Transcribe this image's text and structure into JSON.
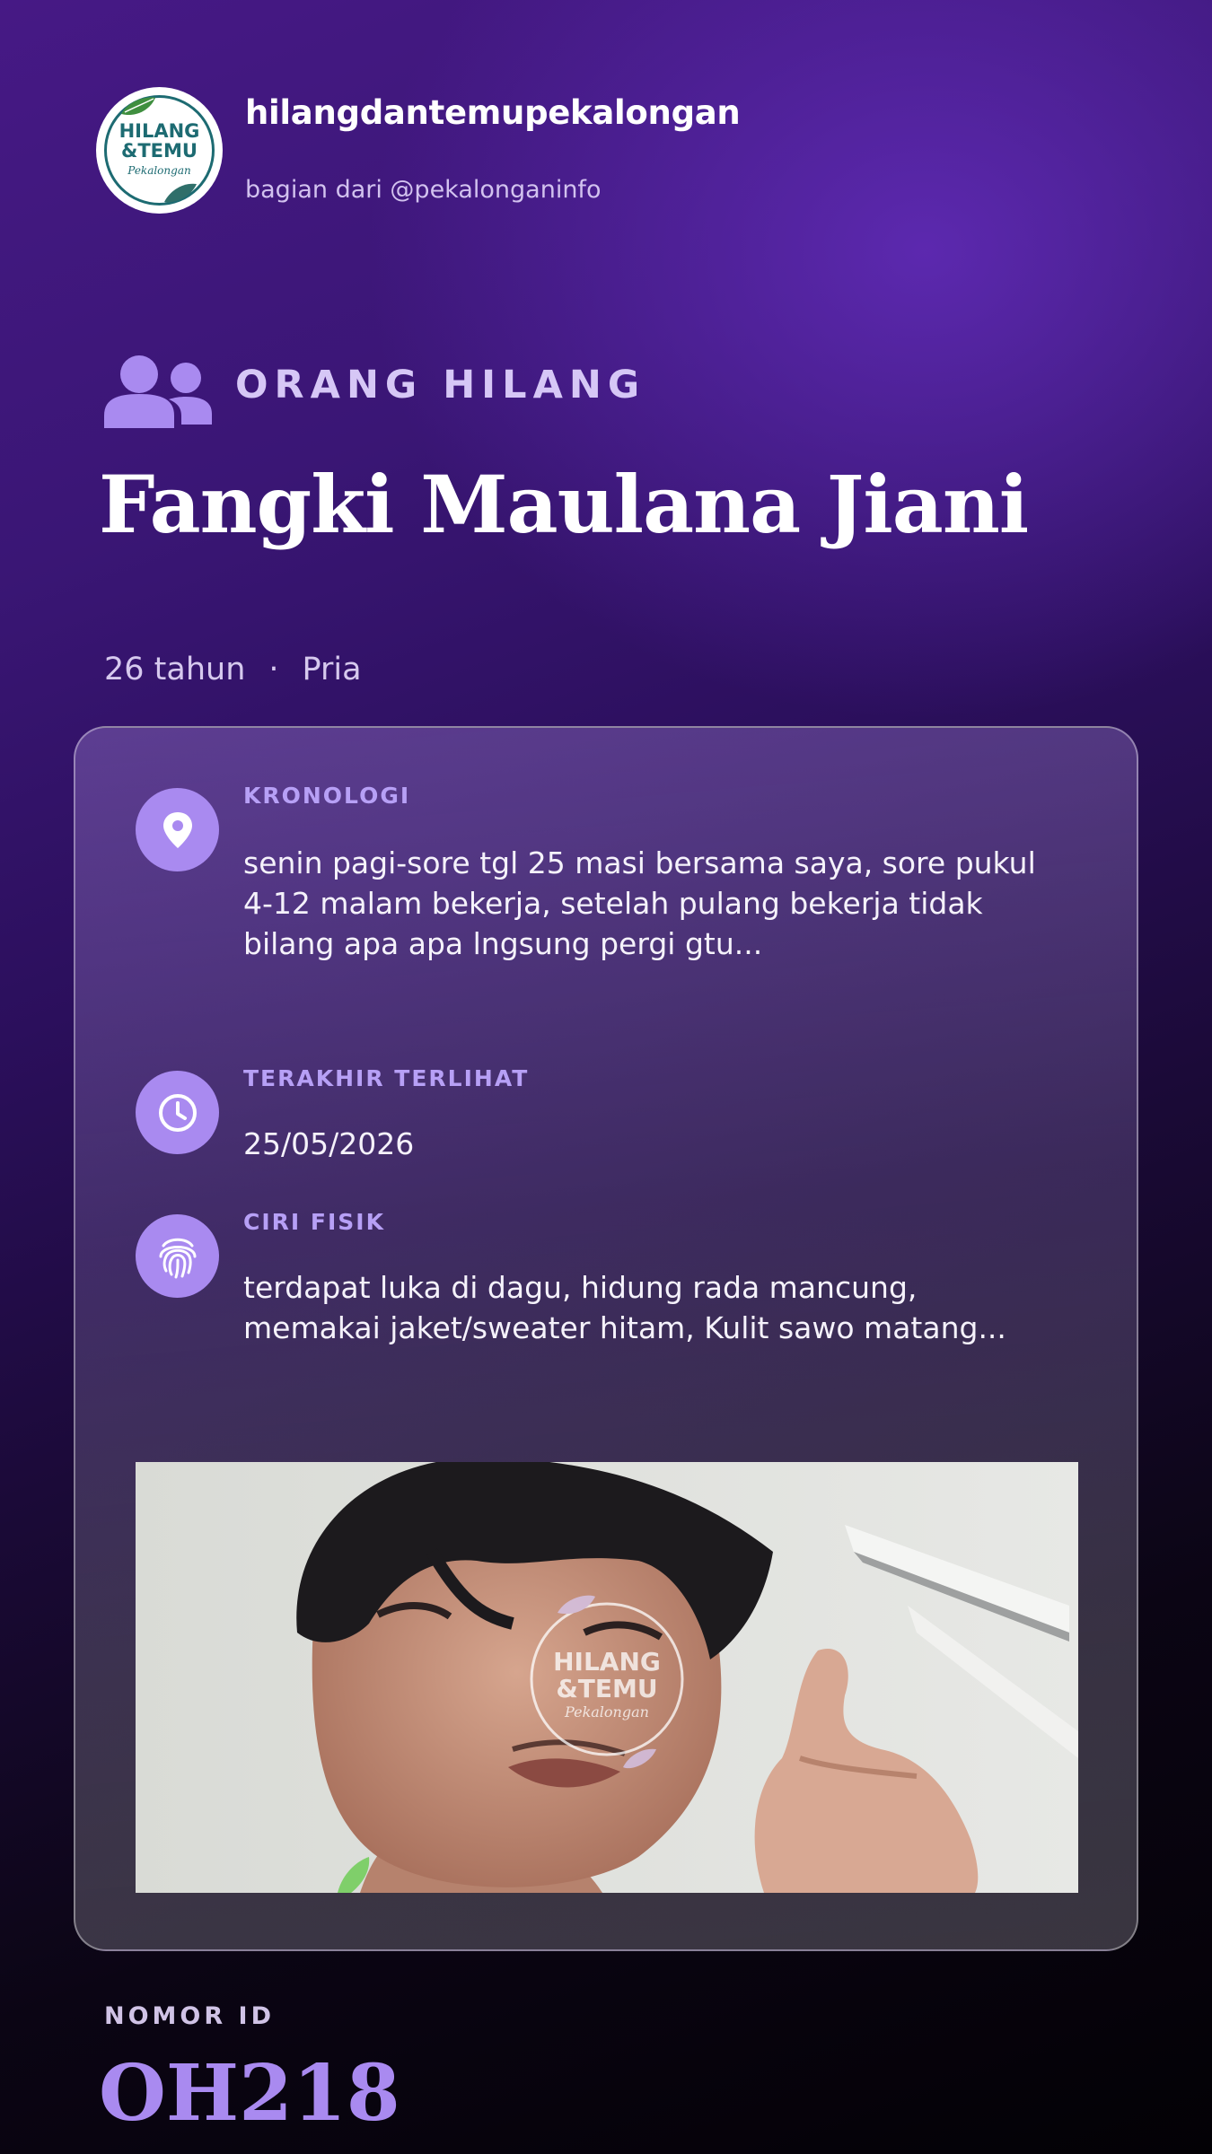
{
  "header": {
    "logo": {
      "icon": "hilang-temu-logo",
      "line1": "HILANG",
      "line2": "&TEMU",
      "line3": "Pekalongan"
    },
    "handle": "hilangdantemupekalongan",
    "subtitle": "bagian dari @pekalonganinfo"
  },
  "category": {
    "icon": "people-icon",
    "label": "ORANG HILANG"
  },
  "person": {
    "name": "Fangki Maulana Jiani",
    "age": "26 tahun",
    "separator": "·",
    "gender": "Pria"
  },
  "details": [
    {
      "icon": "location-pin-icon",
      "label": "KRONOLOGI",
      "text": "senin pagi-sore tgl 25 masi bersama saya, sore pukul 4-12 malam bekerja, setelah pulang bekerja tidak bilang apa apa lngsung pergi gtu..."
    },
    {
      "icon": "clock-icon",
      "label": "TERAKHIR TERLIHAT",
      "text": "25/05/2026"
    },
    {
      "icon": "fingerprint-icon",
      "label": "CIRI FISIK",
      "text": "terdapat luka di dagu, hidung rada mancung, memakai jaket/sweater hitam, Kulit sawo matang..."
    }
  ],
  "photo": {
    "watermark_line1": "HILANG",
    "watermark_line2": "&TEMU",
    "watermark_line3": "Pekalongan"
  },
  "footer": {
    "id_label": "NOMOR ID",
    "id_value": "OH218"
  },
  "colors": {
    "accent": "#a98af0",
    "label": "#b7a0f6",
    "background_top": "#461985",
    "background_bottom": "#030105",
    "logo_text": "#1d6b72",
    "logo_leaf": "#3f8f3f"
  }
}
